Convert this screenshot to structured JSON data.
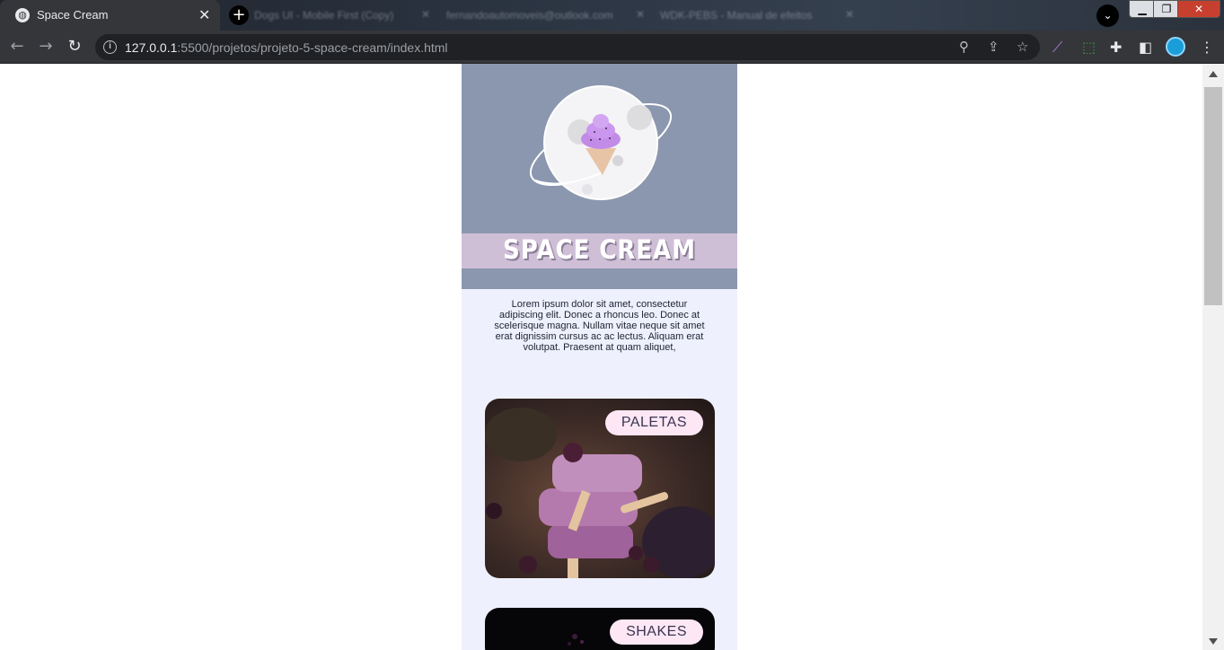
{
  "browser": {
    "active_tab": {
      "title": "Space Cream",
      "favicon": "globe-icon"
    },
    "background_tabs": [
      {
        "title": "Dogs UI - Mobile First (Copy)"
      },
      {
        "title": "fernandoautomoveis@outlook.com"
      },
      {
        "title": "WDK-PEBS - Manual de efeitos"
      }
    ],
    "url": {
      "host": "127.0.0.1",
      "path": ":5500/projetos/projeto-5-space-cream/index.html"
    }
  },
  "page": {
    "brand": "SPACE CREAM",
    "intro": "Lorem ipsum dolor sit amet, consectetur adipiscing elit. Donec a rhoncus leo. Donec at scelerisque magna. Nullam vitae neque sit amet erat dignissim cursus ac ac lectus. Aliquam erat volutpat. Praesent at quam aliquet,",
    "cards": [
      {
        "label": "PALETAS",
        "image": "purple-popsicles-photo"
      },
      {
        "label": "SHAKES",
        "image": "dark-shake-photo"
      }
    ]
  },
  "colors": {
    "hero_bg": "#8b97ae",
    "brand_band": "#cebfd7",
    "page_bg": "#eef0fd",
    "label_bg": "#fde7f5",
    "ice_cream": "#c38be8"
  }
}
